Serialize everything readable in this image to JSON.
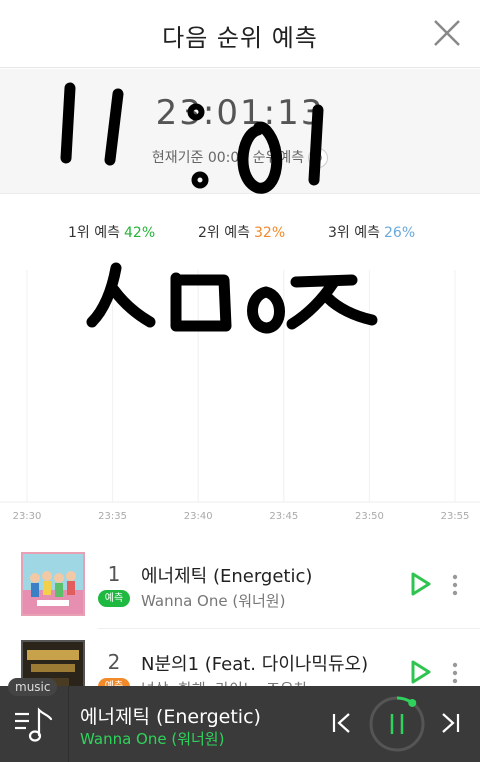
{
  "header": {
    "title": "다음 순위 예측"
  },
  "time_panel": {
    "time": "23:01:13",
    "subtitle": "현재기준 00:00 순위예측"
  },
  "legend": [
    {
      "label": "1위 예측",
      "percent": "42%",
      "color": "#27b33a"
    },
    {
      "label": "2위 예측",
      "percent": "32%",
      "color": "#f28a2a"
    },
    {
      "label": "3위 예측",
      "percent": "26%",
      "color": "#6aa9db"
    }
  ],
  "chart": {
    "x_ticks": [
      "23:30",
      "23:35",
      "23:40",
      "23:45",
      "23:50",
      "23:55"
    ]
  },
  "ranks": [
    {
      "rank": "1",
      "badge": "예측",
      "title": "에너제틱 (Energetic)",
      "artist": "Wanna One (워너원)"
    },
    {
      "rank": "2",
      "badge": "예측",
      "title": "N분의1 (Feat. 다이나믹듀오)",
      "artist": "넉살, 한해, 라이노, 조우찬"
    }
  ],
  "player": {
    "tag": "music",
    "now_title": "에너제틱 (Energetic)",
    "now_artist": "Wanna One (워너원)",
    "progress": 0.1
  },
  "colors": {
    "accent_green": "#2fd35b",
    "badge_green": "#1fb941",
    "badge_orange": "#f28a2a"
  }
}
